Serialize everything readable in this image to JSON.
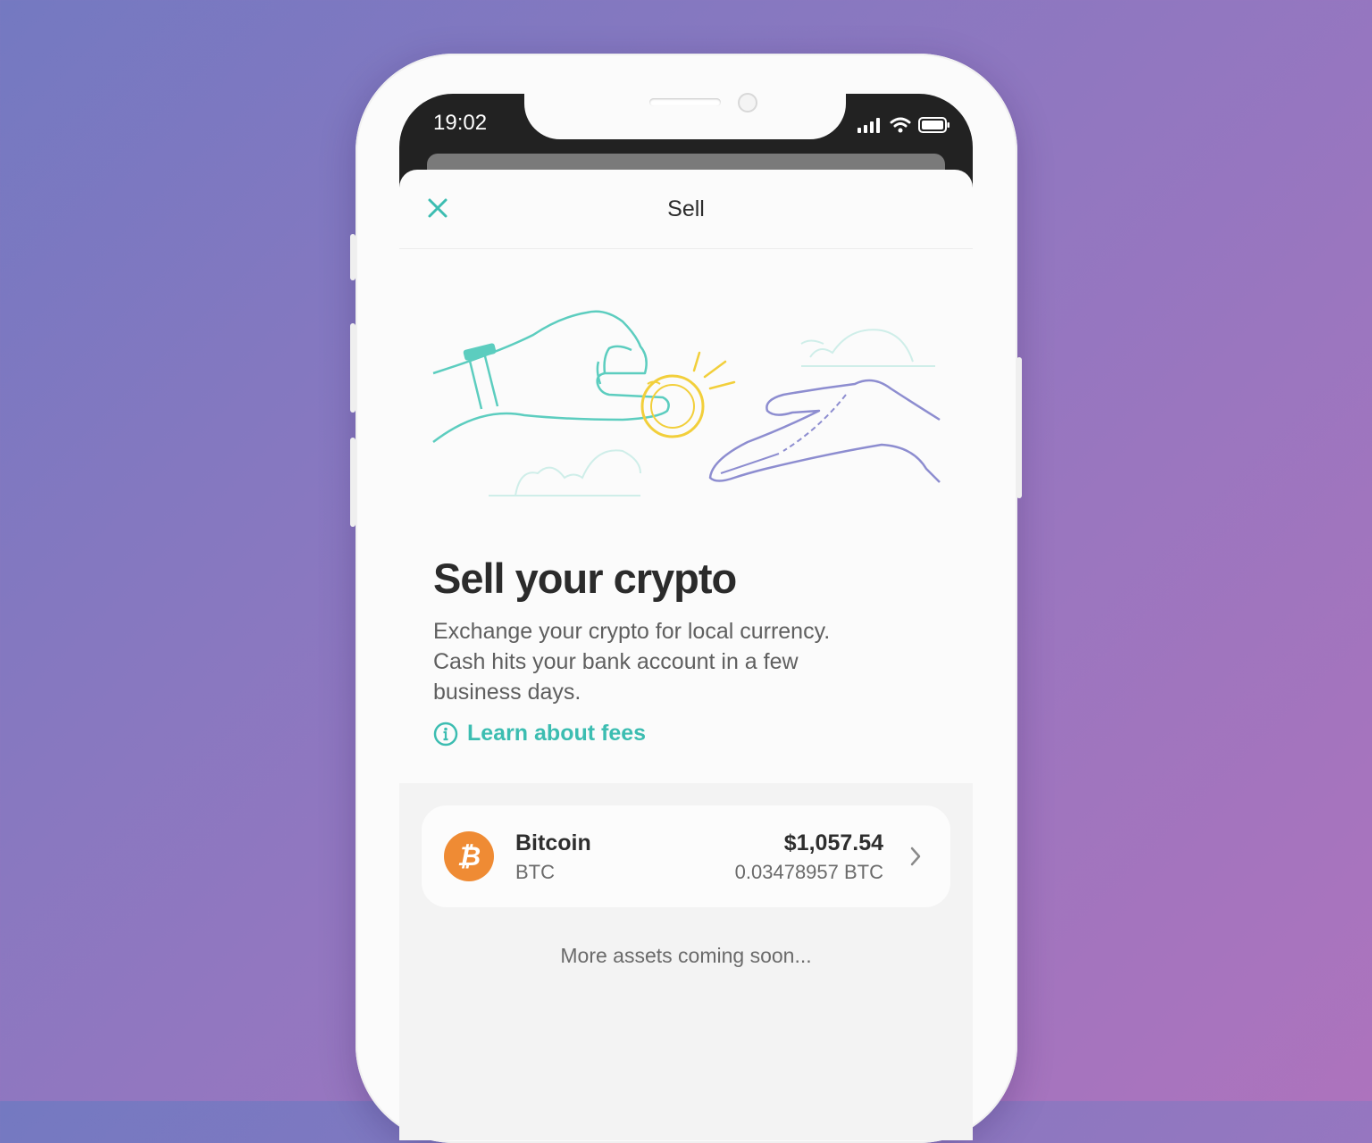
{
  "status_bar": {
    "time": "19:02"
  },
  "header": {
    "title": "Sell"
  },
  "hero": {
    "title": "Sell your crypto",
    "description_lines": [
      "Exchange your crypto for local currency.",
      "Cash hits your bank account in a few",
      "business days."
    ],
    "learn_link": "Learn about fees"
  },
  "assets": [
    {
      "name": "Bitcoin",
      "ticker": "BTC",
      "fiat_value": "$1,057.54",
      "crypto_amount": "0.03478957 BTC",
      "icon": "bitcoin-icon",
      "color": "#ef8b34"
    }
  ],
  "footer_note": "More assets coming soon...",
  "colors": {
    "accent": "#3cbdb1",
    "illustration_teal": "#5ccdbf",
    "illustration_purple": "#8d8dd0",
    "coin_gold": "#f2cf3b"
  }
}
